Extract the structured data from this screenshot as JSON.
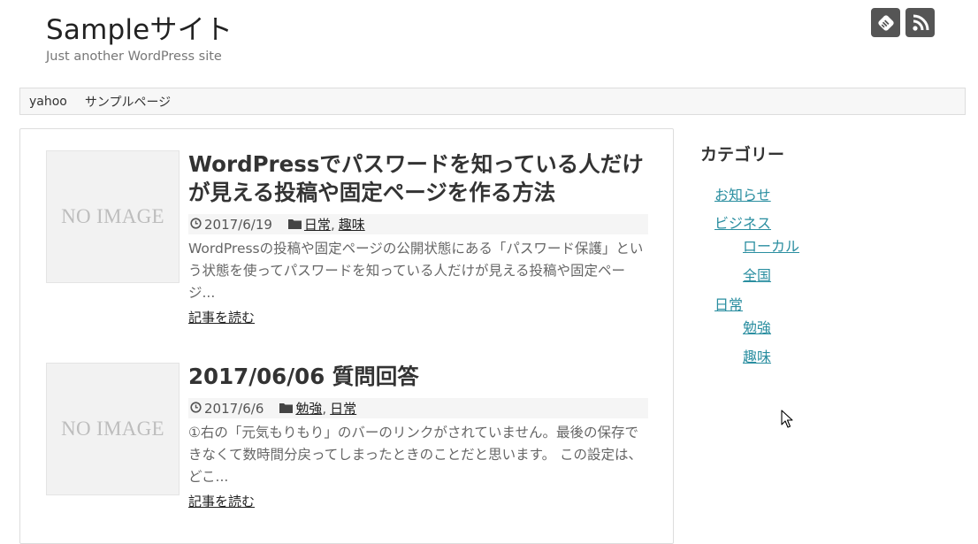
{
  "header": {
    "site_title": "Sampleサイト",
    "site_description": "Just another WordPress site",
    "icons": [
      "feedly-icon",
      "rss-icon"
    ]
  },
  "nav": {
    "items": [
      {
        "label": "yahoo"
      },
      {
        "label": "サンプルページ"
      }
    ]
  },
  "posts": [
    {
      "thumbnail_text": "NO IMAGE",
      "title": "WordPressでパスワードを知っている人だけが見える投稿や固定ページを作る方法",
      "date": "2017/6/19",
      "categories": [
        "日常",
        "趣味"
      ],
      "excerpt": "WordPressの投稿や固定ページの公開状態にある「パスワード保護」という状態を使ってパスワードを知っている人だけが見える投稿や固定ページ...",
      "read_more": "記事を読む"
    },
    {
      "thumbnail_text": "NO IMAGE",
      "title": "2017/06/06 質問回答",
      "date": "2017/6/6",
      "categories": [
        "勉強",
        "日常"
      ],
      "excerpt": "①右の「元気もりもり」のバーのリンクがされていません。最後の保存できなくて数時間分戻ってしまったときのことだと思います。 この設定は、どこ...",
      "read_more": "記事を読む"
    }
  ],
  "sidebar": {
    "widget_title": "カテゴリー",
    "categories": [
      {
        "label": "お知らせ",
        "children": []
      },
      {
        "label": "ビジネス",
        "children": [
          {
            "label": "ローカル"
          },
          {
            "label": "全国"
          }
        ]
      },
      {
        "label": "日常",
        "children": [
          {
            "label": "勉強"
          },
          {
            "label": "趣味"
          }
        ]
      }
    ]
  },
  "colors": {
    "link": "#2a8ea0",
    "icon_bg": "#555555",
    "border": "#dddddd"
  }
}
